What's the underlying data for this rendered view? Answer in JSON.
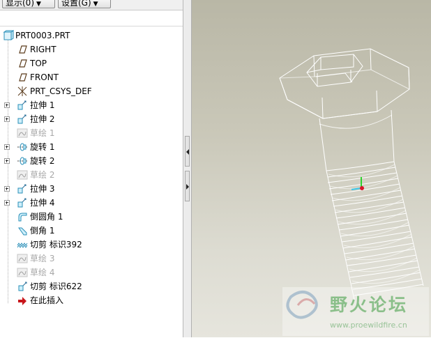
{
  "toolbar": {
    "show_label": "显示(0)",
    "settings_label": "设置(G)"
  },
  "tree": {
    "items": [
      {
        "label": "PRT0003.PRT",
        "icon": "part-icon"
      },
      {
        "label": "RIGHT",
        "icon": "datum-plane-icon"
      },
      {
        "label": "TOP",
        "icon": "datum-plane-icon"
      },
      {
        "label": "FRONT",
        "icon": "datum-plane-icon"
      },
      {
        "label": "PRT_CSYS_DEF",
        "icon": "coordinate-system-icon"
      },
      {
        "label": "拉伸 1",
        "icon": "extrude-icon"
      },
      {
        "label": "拉伸 2",
        "icon": "extrude-icon"
      },
      {
        "label": "草绘 1",
        "icon": "sketch-icon"
      },
      {
        "label": "旋转 1",
        "icon": "revolve-icon"
      },
      {
        "label": "旋转 2",
        "icon": "revolve-icon"
      },
      {
        "label": "草绘 2",
        "icon": "sketch-icon"
      },
      {
        "label": "拉伸 3",
        "icon": "extrude-icon"
      },
      {
        "label": "拉伸 4",
        "icon": "extrude-icon"
      },
      {
        "label": "倒圆角 1",
        "icon": "round-icon"
      },
      {
        "label": "倒角 1",
        "icon": "chamfer-icon"
      },
      {
        "label": "切剪 标识392",
        "icon": "cut-icon"
      },
      {
        "label": "草绘 3",
        "icon": "sketch-icon"
      },
      {
        "label": "草绘 4",
        "icon": "sketch-icon"
      },
      {
        "label": "切剪 标识622",
        "icon": "cut-icon"
      },
      {
        "label": "在此插入",
        "icon": "insert-here-arrow-icon"
      }
    ]
  },
  "watermark": {
    "title": "野火论坛",
    "url": "www.proewildfire.cn"
  },
  "colors": {
    "viewport_top": "#b9b7a6",
    "viewport_bottom": "#e6e5dd",
    "watermark_green": "#7ab87a"
  }
}
